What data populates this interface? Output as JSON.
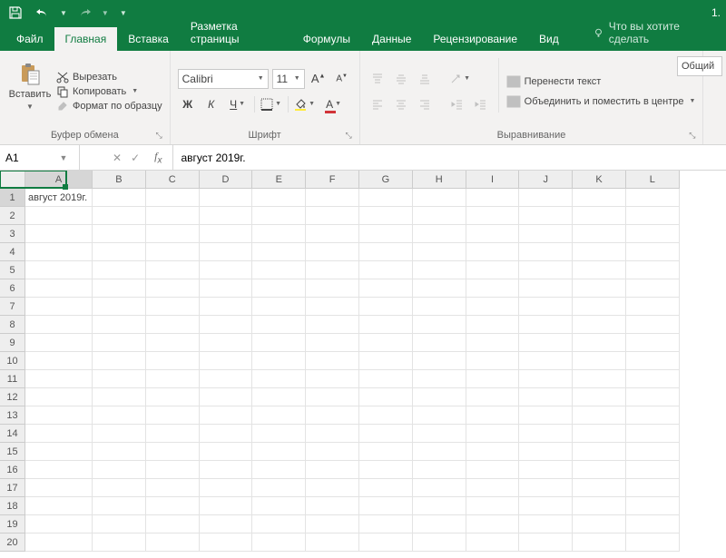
{
  "titlebar": {
    "title_fragment": "1."
  },
  "tabs": {
    "file": "Файл",
    "home": "Главная",
    "insert": "Вставка",
    "page_layout": "Разметка страницы",
    "formulas": "Формулы",
    "data": "Данные",
    "review": "Рецензирование",
    "view": "Вид",
    "tell_me": "Что вы хотите сделать"
  },
  "ribbon": {
    "clipboard": {
      "paste": "Вставить",
      "cut": "Вырезать",
      "copy": "Копировать",
      "format_painter": "Формат по образцу",
      "title": "Буфер обмена"
    },
    "font": {
      "name": "Calibri",
      "size": "11",
      "bold": "Ж",
      "italic": "К",
      "underline": "Ч",
      "title": "Шрифт"
    },
    "alignment": {
      "wrap": "Перенести текст",
      "merge": "Объединить и поместить в центре",
      "title": "Выравнивание"
    },
    "number_format": "Общий"
  },
  "formula_bar": {
    "cell_ref": "A1",
    "value": "август 2019г."
  },
  "sheet": {
    "columns": [
      "A",
      "B",
      "C",
      "D",
      "E",
      "F",
      "G",
      "H",
      "I",
      "J",
      "K",
      "L"
    ],
    "rows": [
      1,
      2,
      3,
      4,
      5,
      6,
      7,
      8,
      9,
      10,
      11,
      12,
      13,
      14,
      15,
      16,
      17,
      18,
      19,
      20
    ],
    "active": {
      "col": "A",
      "row": 1
    },
    "cells": {
      "A1": "август 2019г."
    }
  }
}
